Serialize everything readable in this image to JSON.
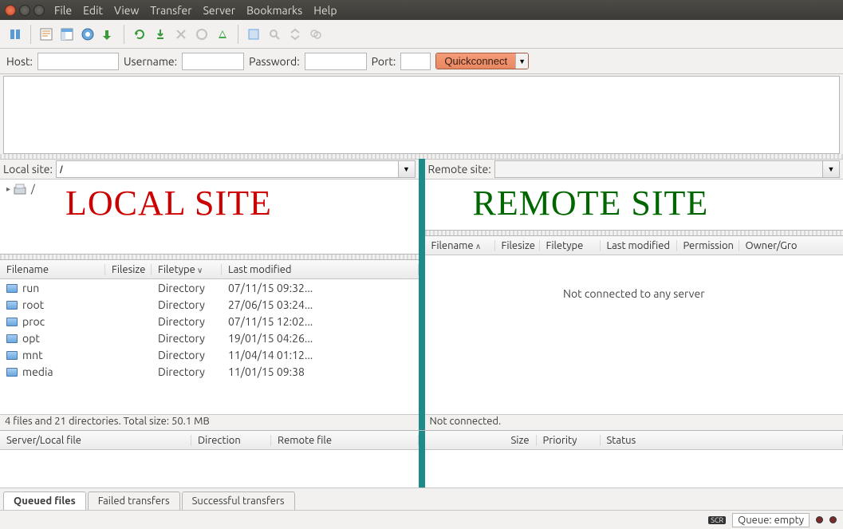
{
  "menu": {
    "items": [
      "File",
      "Edit",
      "View",
      "Transfer",
      "Server",
      "Bookmarks",
      "Help"
    ]
  },
  "connect": {
    "host_label": "Host:",
    "user_label": "Username:",
    "pass_label": "Password:",
    "port_label": "Port:",
    "host": "",
    "user": "",
    "pass": "",
    "port": "",
    "quickconnect": "Quickconnect"
  },
  "local": {
    "label": "Local site:",
    "path": "/",
    "overlay": "LOCAL SITE",
    "tree_root": "/",
    "columns": [
      "Filename",
      "Filesize",
      "Filetype",
      "Last modified"
    ],
    "rows": [
      {
        "name": "run",
        "size": "",
        "type": "Directory",
        "mod": "07/11/15 09:32..."
      },
      {
        "name": "root",
        "size": "",
        "type": "Directory",
        "mod": "27/06/15 03:24..."
      },
      {
        "name": "proc",
        "size": "",
        "type": "Directory",
        "mod": "07/11/15 12:02..."
      },
      {
        "name": "opt",
        "size": "",
        "type": "Directory",
        "mod": "19/01/15 04:26..."
      },
      {
        "name": "mnt",
        "size": "",
        "type": "Directory",
        "mod": "11/04/14 01:12..."
      },
      {
        "name": "media",
        "size": "",
        "type": "Directory",
        "mod": "11/01/15 09:38"
      }
    ],
    "status": "4 files and 21 directories. Total size: 50.1 MB"
  },
  "remote": {
    "label": "Remote site:",
    "path": "",
    "overlay": "REMOTE SITE",
    "columns": [
      "Filename",
      "Filesize",
      "Filetype",
      "Last modified",
      "Permission",
      "Owner/Gro"
    ],
    "empty": "Not connected to any server",
    "status": "Not connected."
  },
  "queue": {
    "left_cols": [
      "Server/Local file",
      "Direction",
      "Remote file"
    ],
    "right_cols": [
      "Size",
      "Priority",
      "Status"
    ]
  },
  "tabs": {
    "items": [
      "Queued files",
      "Failed transfers",
      "Successful transfers"
    ],
    "active": 0
  },
  "bottom": {
    "queue": "Queue: empty"
  }
}
